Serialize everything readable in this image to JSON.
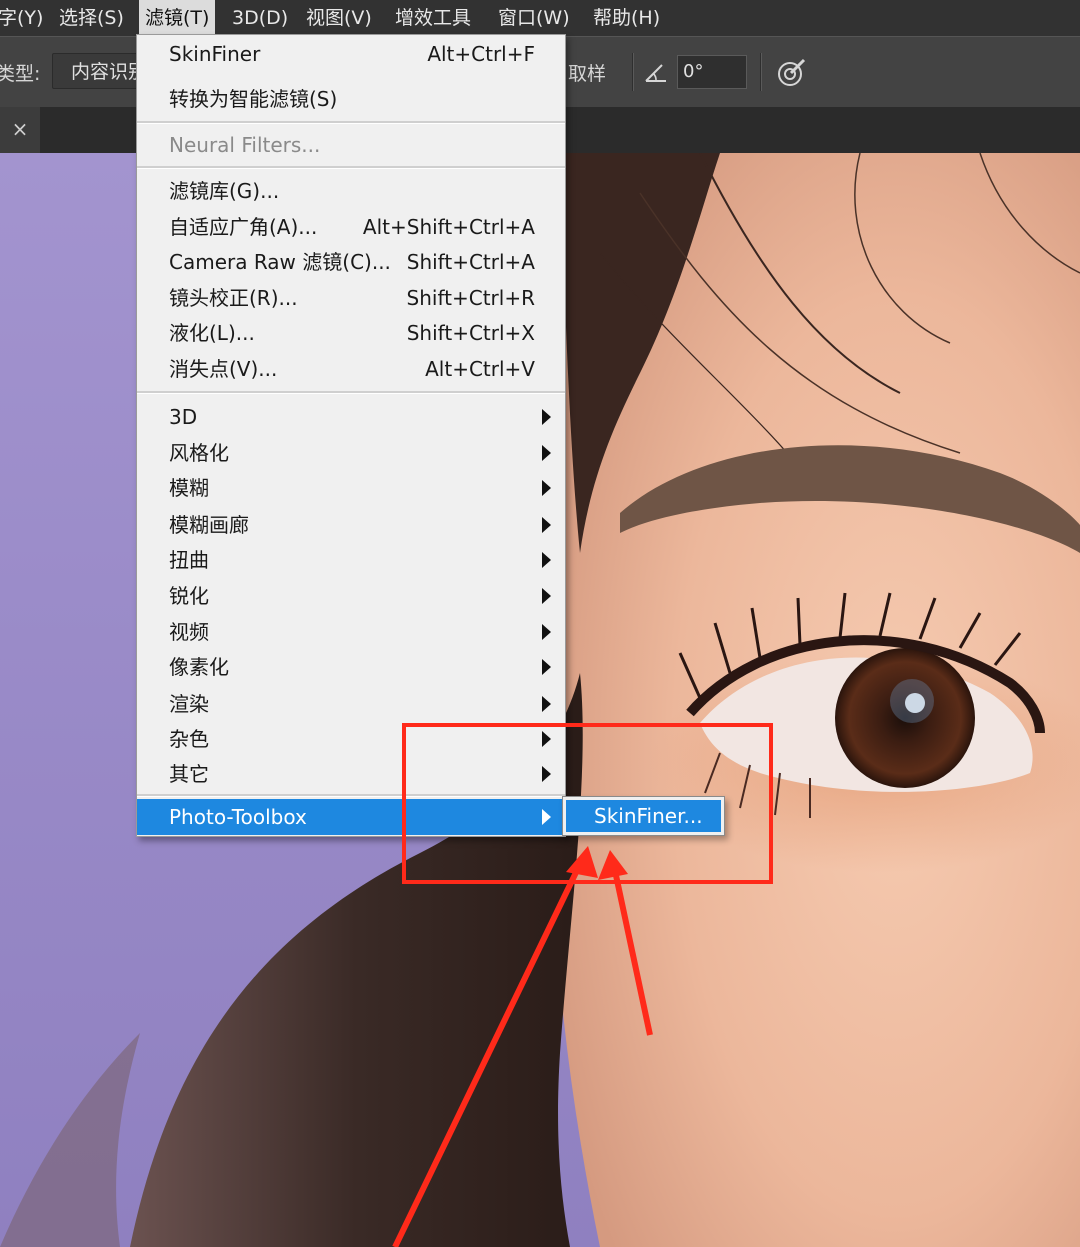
{
  "menubar": {
    "items": [
      "字(Y)",
      "选择(S)",
      "滤镜(T)",
      "3D(D)",
      "视图(V)",
      "增效工具",
      "窗口(W)",
      "帮助(H)"
    ]
  },
  "options": {
    "type_label": "类型:",
    "type_value": "内容识别",
    "sample_label": "取样",
    "angle_value": "0°"
  },
  "tabbar": {
    "close_glyph": "×"
  },
  "filter_menu": {
    "last_filter": {
      "label": "SkinFiner",
      "shortcut": "Alt+Ctrl+F"
    },
    "smart_filter": {
      "label": "转换为智能滤镜(S)"
    },
    "neural": {
      "label": "Neural Filters..."
    },
    "gallery": {
      "label": "滤镜库(G)..."
    },
    "adaptive": {
      "label": "自适应广角(A)...",
      "shortcut": "Alt+Shift+Ctrl+A"
    },
    "camera_raw": {
      "label": "Camera Raw 滤镜(C)...",
      "shortcut": "Shift+Ctrl+A"
    },
    "lens": {
      "label": "镜头校正(R)...",
      "shortcut": "Shift+Ctrl+R"
    },
    "liquify": {
      "label": "液化(L)...",
      "shortcut": "Shift+Ctrl+X"
    },
    "vanishing": {
      "label": "消失点(V)...",
      "shortcut": "Alt+Ctrl+V"
    },
    "groups": [
      "3D",
      "风格化",
      "模糊",
      "模糊画廊",
      "扭曲",
      "锐化",
      "视频",
      "像素化",
      "渲染",
      "杂色",
      "其它"
    ],
    "plugin": {
      "label": "Photo-Toolbox"
    }
  },
  "submenu": {
    "item": "SkinFiner..."
  },
  "colors": {
    "highlight": "#1e88e0",
    "annotation": "#ff2a1a",
    "background": "#9b8ec9"
  },
  "icons": [
    "angle-icon",
    "target-brush-icon",
    "submenu-arrow-icon",
    "close-icon"
  ]
}
